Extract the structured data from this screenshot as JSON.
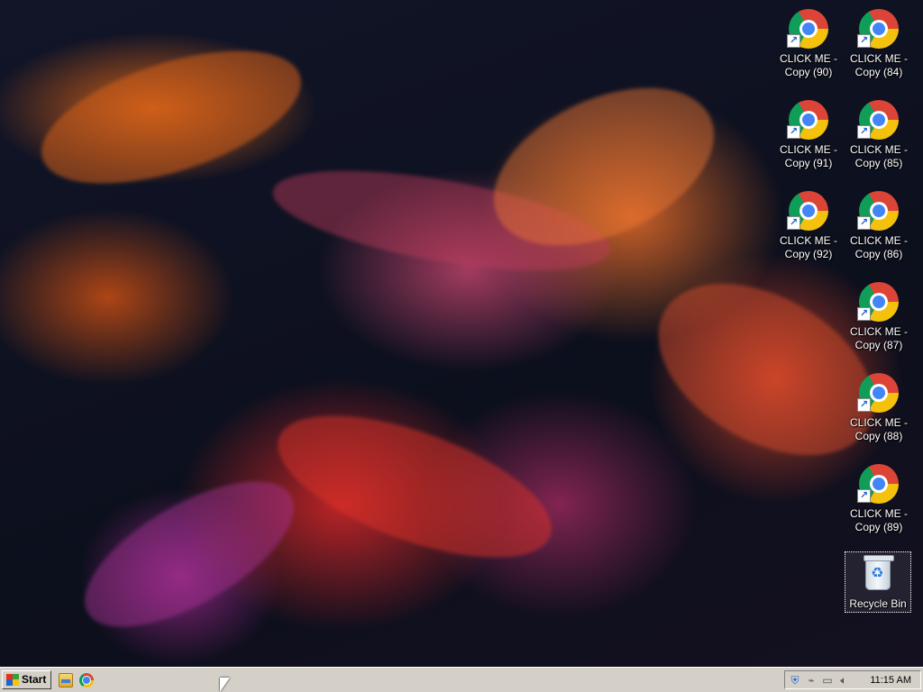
{
  "desktop": {
    "icons": [
      {
        "label": "CLICK ME - Copy (90)",
        "icon": "chrome-icon",
        "shortcut": true
      },
      {
        "label": "CLICK ME - Copy (84)",
        "icon": "chrome-icon",
        "shortcut": true
      },
      {
        "label": "CLICK ME - Copy (91)",
        "icon": "chrome-icon",
        "shortcut": true
      },
      {
        "label": "CLICK ME - Copy (85)",
        "icon": "chrome-icon",
        "shortcut": true
      },
      {
        "label": "CLICK ME - Copy (92)",
        "icon": "chrome-icon",
        "shortcut": true
      },
      {
        "label": "CLICK ME - Copy (86)",
        "icon": "chrome-icon",
        "shortcut": true
      },
      {
        "label": "CLICK ME - Copy (87)",
        "icon": "chrome-icon",
        "shortcut": true
      },
      {
        "label": "CLICK ME - Copy (88)",
        "icon": "chrome-icon",
        "shortcut": true
      },
      {
        "label": "CLICK ME - Copy (89)",
        "icon": "chrome-icon",
        "shortcut": true
      },
      {
        "label": "Recycle Bin",
        "icon": "recycle-bin-icon",
        "shortcut": false,
        "selected": true
      }
    ]
  },
  "taskbar": {
    "start_label": "Start",
    "quick_launch": [
      "folder-icon",
      "chrome-icon"
    ],
    "tray_icons": [
      "security-shield-icon",
      "network-icon",
      "display-icon",
      "volume-icon"
    ],
    "clock": "11:15 AM"
  },
  "colors": {
    "taskbar_bg": "#d4d0c8",
    "chrome_red": "#db4437",
    "chrome_yellow": "#f4c20d",
    "chrome_green": "#0f9d58",
    "chrome_blue": "#4285f4"
  }
}
